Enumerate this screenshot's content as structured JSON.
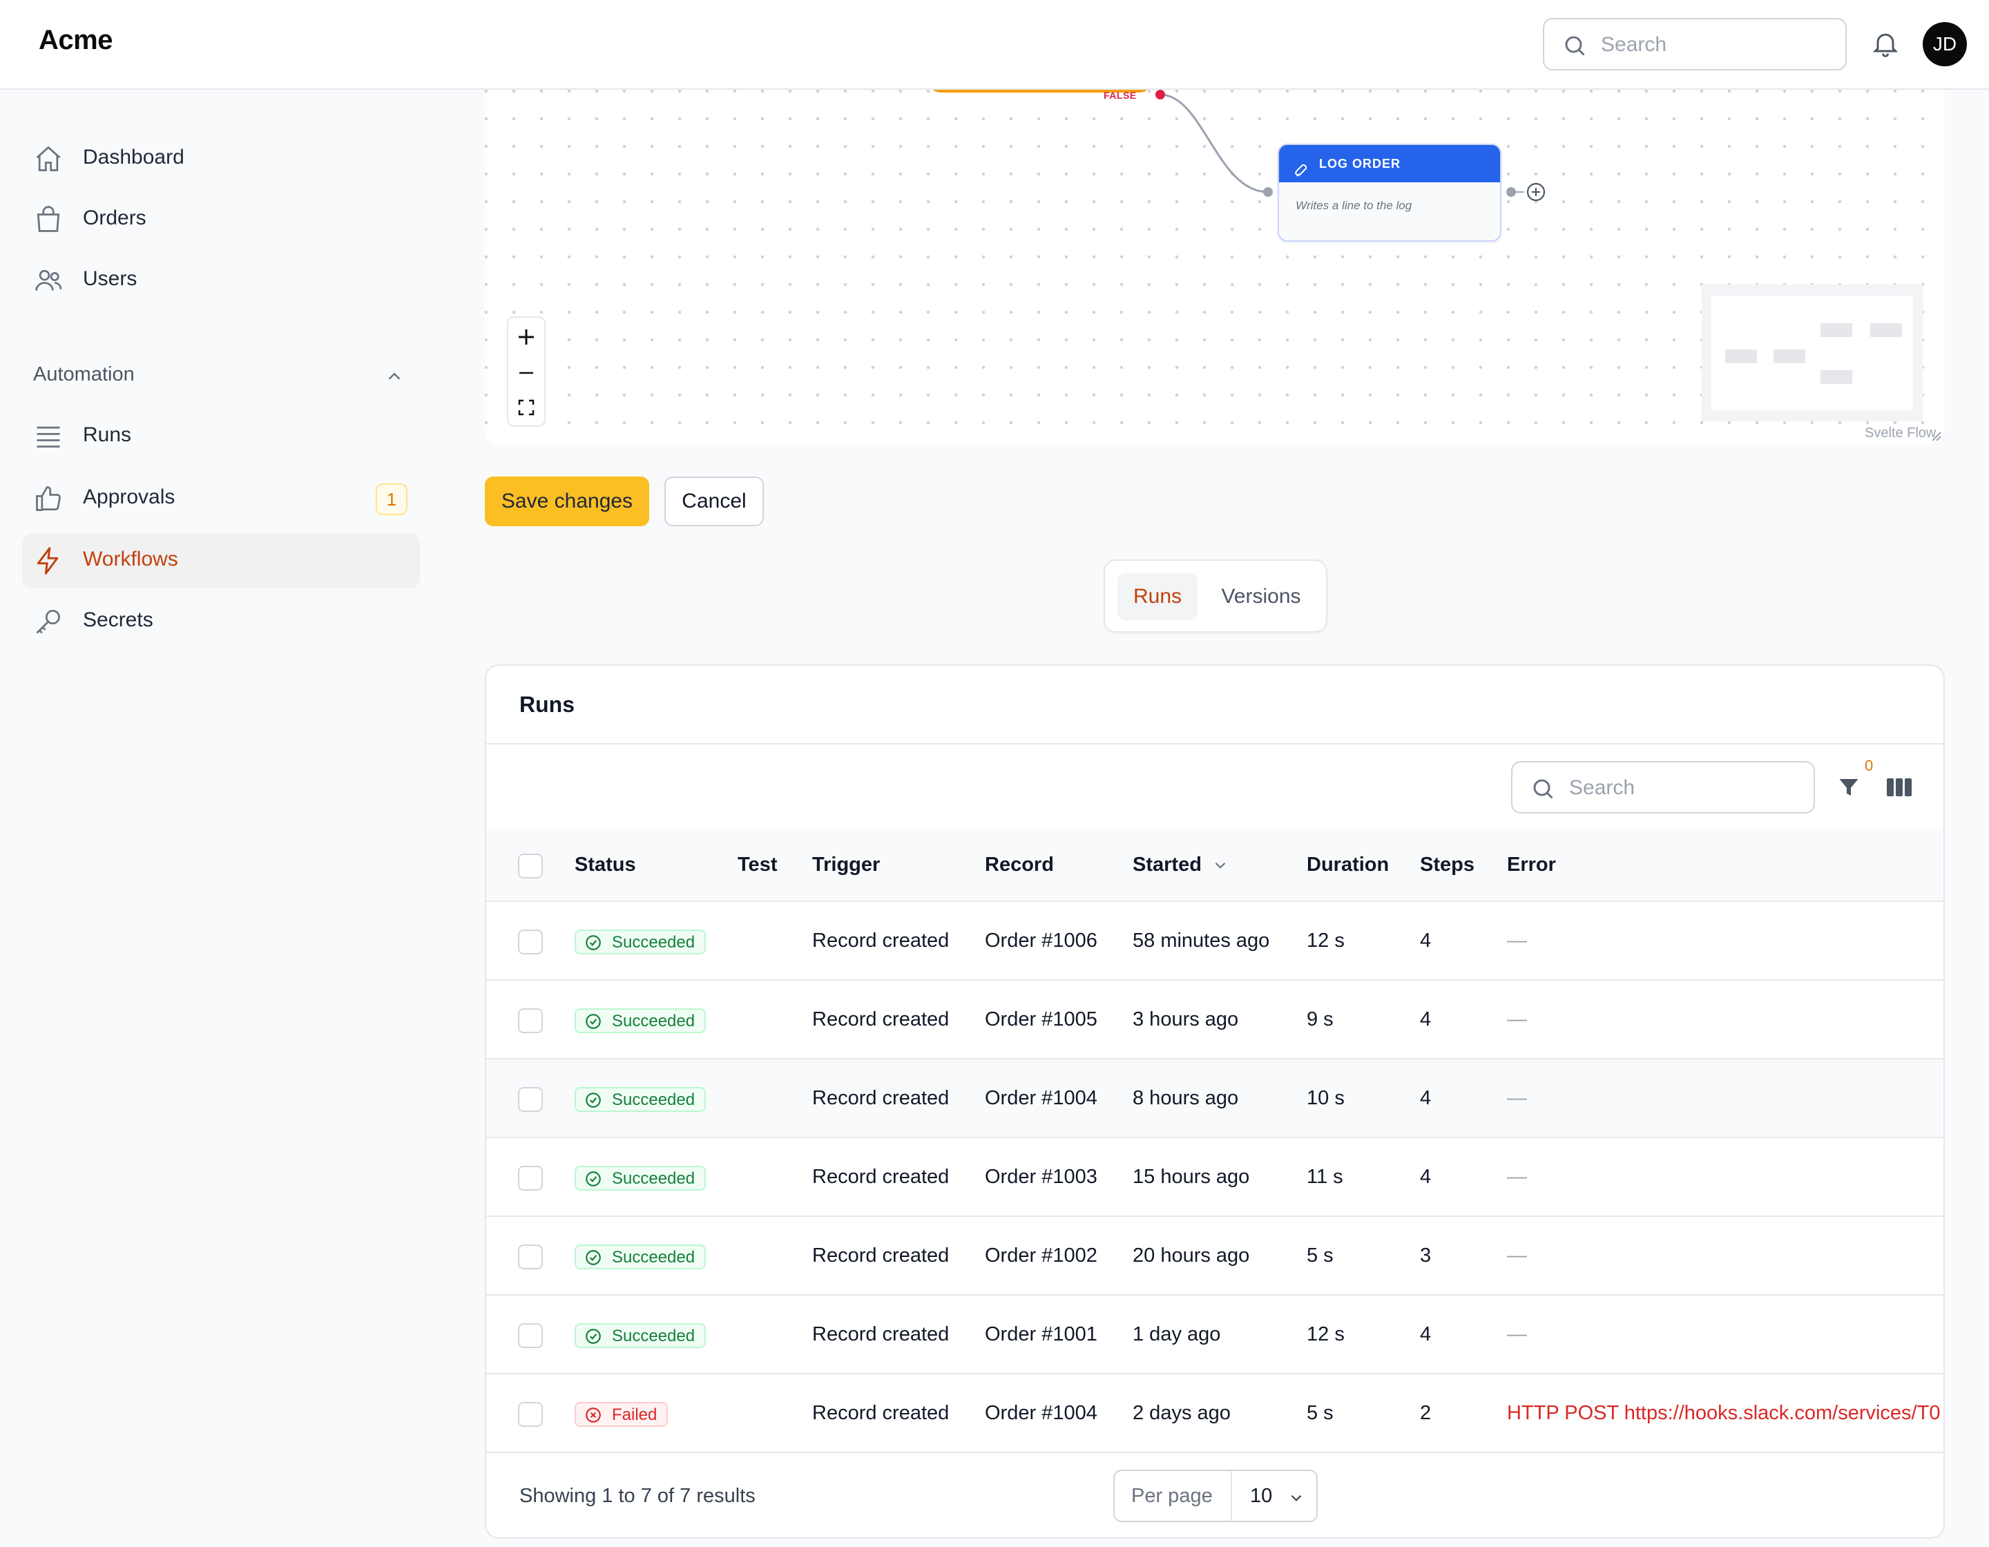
{
  "app": {
    "brand": "Acme",
    "user_initials": "JD"
  },
  "header": {
    "search_placeholder": "Search"
  },
  "sidebar": {
    "items": [
      {
        "label": "Dashboard",
        "icon": "home-icon"
      },
      {
        "label": "Orders",
        "icon": "shopping-bag-icon"
      },
      {
        "label": "Users",
        "icon": "users-icon"
      }
    ],
    "group": {
      "label": "Automation",
      "items": [
        {
          "label": "Runs",
          "icon": "list-icon"
        },
        {
          "label": "Approvals",
          "icon": "thumbs-up-icon",
          "badge": "1"
        },
        {
          "label": "Workflows",
          "icon": "bolt-icon",
          "active": true
        },
        {
          "label": "Secrets",
          "icon": "key-icon"
        }
      ]
    }
  },
  "canvas": {
    "branch_label": "FALSE",
    "node": {
      "title": "LOG ORDER",
      "description": "Writes a line to the log",
      "icon": "rocket-icon"
    },
    "attribution": "Svelte Flow"
  },
  "actions": {
    "save_label": "Save changes",
    "cancel_label": "Cancel"
  },
  "tabs": [
    {
      "label": "Runs",
      "active": true
    },
    {
      "label": "Versions"
    }
  ],
  "runs": {
    "title": "Runs",
    "search_placeholder": "Search",
    "filter_count": "0",
    "columns": [
      "Status",
      "Test",
      "Trigger",
      "Record",
      "Started",
      "Duration",
      "Steps",
      "Error"
    ],
    "rows": [
      {
        "status": "Succeeded",
        "test": "",
        "trigger": "Record created",
        "record": "Order #1006",
        "started": "58 minutes ago",
        "duration": "12 s",
        "steps": "4",
        "error": "—"
      },
      {
        "status": "Succeeded",
        "test": "",
        "trigger": "Record created",
        "record": "Order #1005",
        "started": "3 hours ago",
        "duration": "9 s",
        "steps": "4",
        "error": "—"
      },
      {
        "status": "Succeeded",
        "test": "",
        "trigger": "Record created",
        "record": "Order #1004",
        "started": "8 hours ago",
        "duration": "10 s",
        "steps": "4",
        "error": "—"
      },
      {
        "status": "Succeeded",
        "test": "",
        "trigger": "Record created",
        "record": "Order #1003",
        "started": "15 hours ago",
        "duration": "11 s",
        "steps": "4",
        "error": "—"
      },
      {
        "status": "Succeeded",
        "test": "",
        "trigger": "Record created",
        "record": "Order #1002",
        "started": "20 hours ago",
        "duration": "5 s",
        "steps": "3",
        "error": "—"
      },
      {
        "status": "Succeeded",
        "test": "",
        "trigger": "Record created",
        "record": "Order #1001",
        "started": "1 day ago",
        "duration": "12 s",
        "steps": "4",
        "error": "—"
      },
      {
        "status": "Failed",
        "test": "",
        "trigger": "Record created",
        "record": "Order #1004",
        "started": "2 days ago",
        "duration": "5 s",
        "steps": "2",
        "error": "HTTP POST https://hooks.slack.com/services/T0"
      }
    ],
    "footer": {
      "summary": "Showing 1 to 7 of 7 results",
      "per_page_label": "Per page",
      "per_page_value": "10"
    }
  },
  "colors": {
    "accent": "#c2410c",
    "primary_button": "#fbbf24",
    "node_header": "#2563eb",
    "success": "#15803d",
    "danger": "#dc2626"
  }
}
